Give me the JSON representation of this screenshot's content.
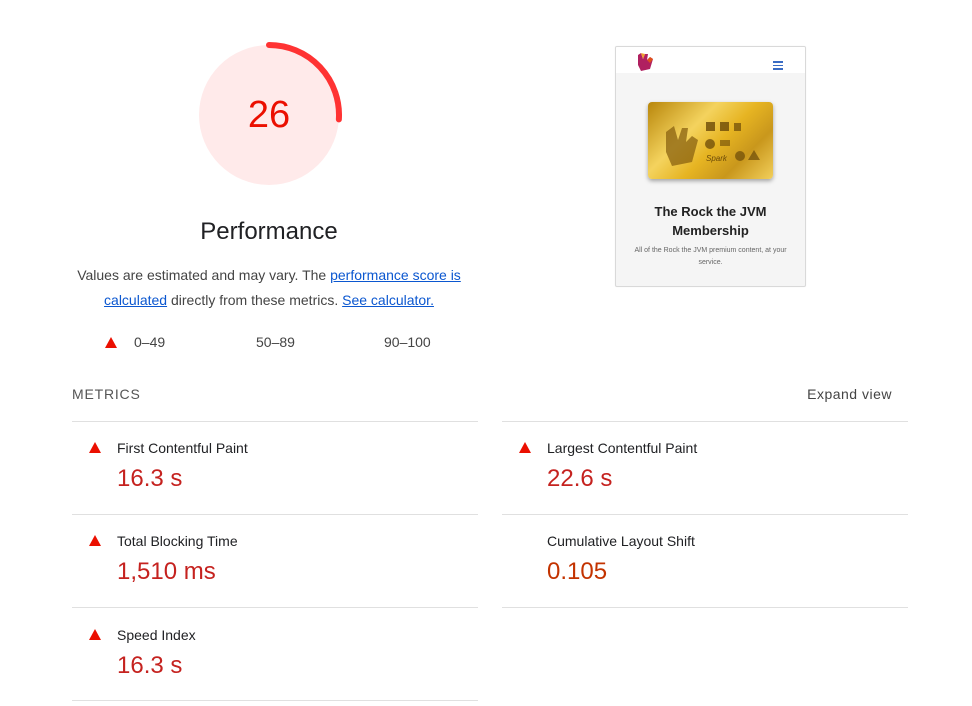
{
  "gauge": {
    "score": "26",
    "fraction": 0.26,
    "color": "#ff3333",
    "bg": "#ffeaea"
  },
  "category_title": "Performance",
  "description": {
    "pre": "Values are estimated and may vary. The ",
    "link1": "performance score is calculated",
    "mid": " directly from these metrics. ",
    "link2": "See calculator."
  },
  "legend": {
    "fail": "0–49",
    "average": "50–89",
    "pass": "90–100",
    "colors": {
      "fail": "#ff3333",
      "average": "#ffaa33",
      "pass": "#00cc66"
    }
  },
  "thumbnail": {
    "title": "The Rock the JVM Membership",
    "subtitle": "All of the Rock the JVM premium content, at your service.",
    "card_text": "Spark"
  },
  "metrics_header": "METRICS",
  "expand_label": "Expand view",
  "metrics": [
    {
      "name": "First Contentful Paint",
      "value": "16.3 s",
      "rating": "fail"
    },
    {
      "name": "Largest Contentful Paint",
      "value": "22.6 s",
      "rating": "fail"
    },
    {
      "name": "Total Blocking Time",
      "value": "1,510 ms",
      "rating": "fail"
    },
    {
      "name": "Cumulative Layout Shift",
      "value": "0.105",
      "rating": "average"
    },
    {
      "name": "Speed Index",
      "value": "16.3 s",
      "rating": "fail"
    }
  ]
}
